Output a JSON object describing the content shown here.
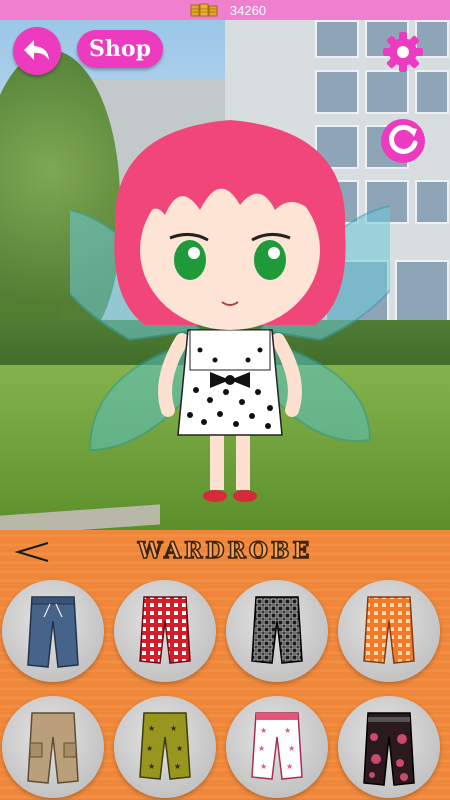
{
  "status": {
    "coins": "34260",
    "coin_icon": "coin-stack-icon"
  },
  "toolbar": {
    "shop_label": "Shop",
    "back_icon": "back-arrow-icon",
    "settings_icon": "gear-icon",
    "reset_icon": "refresh-icon"
  },
  "wardrobe": {
    "title": "WARDROBE",
    "prev_icon": "chevron-left-icon",
    "items": [
      {
        "name": "denim-capri-pants",
        "color": "#46648a"
      },
      {
        "name": "red-plaid-shorts",
        "color": "#d41e2a"
      },
      {
        "name": "black-grid-shorts",
        "color": "#1a1a1a"
      },
      {
        "name": "orange-plaid-shorts",
        "color": "#f07a28"
      },
      {
        "name": "khaki-cargo-pants",
        "color": "#b9a07a"
      },
      {
        "name": "olive-star-shorts",
        "color": "#98961f"
      },
      {
        "name": "pink-star-shorts",
        "color": "#e8557a"
      },
      {
        "name": "black-pink-camo-pants",
        "color": "#2a1a1e"
      }
    ]
  },
  "colors": {
    "accent": "#ed3bbf",
    "status_bar": "#f17fd0",
    "wardrobe_bg": "#f08a3c"
  }
}
